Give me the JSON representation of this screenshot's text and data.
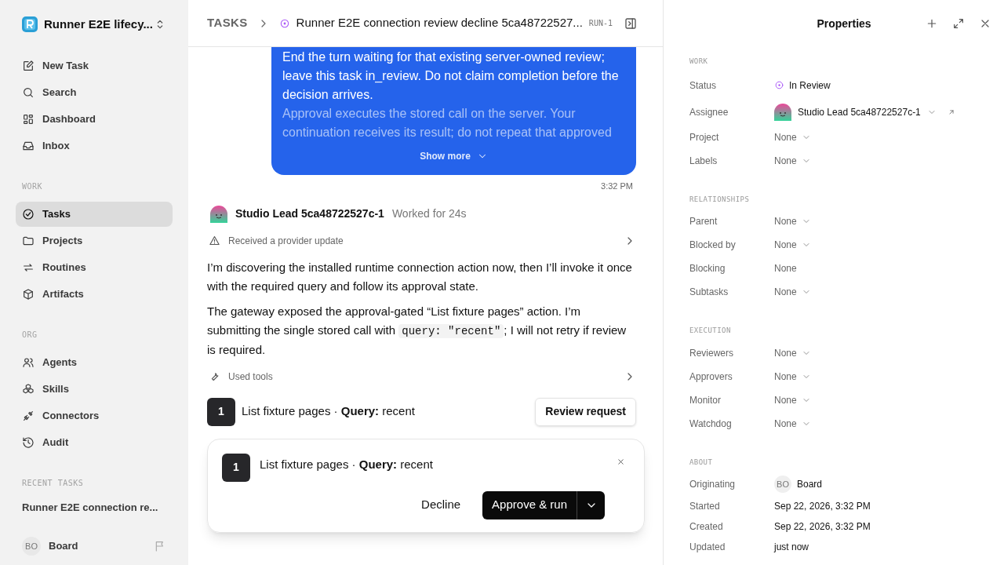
{
  "workspace": {
    "name": "Runner E2E lifecy..."
  },
  "sidebar": {
    "top_items": [
      {
        "label": "New Task"
      },
      {
        "label": "Search"
      },
      {
        "label": "Dashboard"
      },
      {
        "label": "Inbox"
      }
    ],
    "sections": [
      {
        "heading": "WORK",
        "items": [
          {
            "label": "Tasks",
            "selected": true
          },
          {
            "label": "Projects",
            "selected": false
          },
          {
            "label": "Routines",
            "selected": false
          },
          {
            "label": "Artifacts",
            "selected": false
          }
        ]
      },
      {
        "heading": "ORG",
        "items": [
          {
            "label": "Agents",
            "selected": false
          },
          {
            "label": "Skills",
            "selected": false
          },
          {
            "label": "Connectors",
            "selected": false
          },
          {
            "label": "Audit",
            "selected": false
          }
        ]
      }
    ],
    "recent": {
      "heading": "RECENT TASKS",
      "items": [
        "Runner E2E connection re..."
      ]
    },
    "user": {
      "initials": "BO",
      "name": "Board"
    }
  },
  "header": {
    "breadcrumb": "TASKS",
    "title": "Runner E2E connection review decline 5ca48722527...",
    "run": "RUN-1"
  },
  "message": {
    "text": "End the turn waiting for that existing server-owned review; leave this task in_review. Do not claim completion before the decision arrives.",
    "faded_text": "Approval executes the stored call on the server. Your continuation receives its result; do not repeat that approved",
    "show_more": "Show more",
    "time": "3:32 PM"
  },
  "agent": {
    "name": "Studio Lead 5ca48722527c-1",
    "worked": "Worked for 24s",
    "event": "Received a provider update",
    "paragraphs": [
      {
        "text": "I’m discovering the installed runtime connection action now, then I’ll invoke it once with the required query and follow its approval state."
      },
      {
        "text": "The gateway exposed the approval-gated “List fixture pages” action. I’m submitting the single stored call with ",
        "code": "query: \"recent\"",
        "after": "; I will not retry if review is required."
      }
    ],
    "tools": "Used tools",
    "request": {
      "number": "1",
      "text": "List fixture pages · **Query:** recent",
      "button": "Review request"
    }
  },
  "approval": {
    "number": "1",
    "text": "List fixture pages · **Query:** recent",
    "decline": "Decline",
    "approve": "Approve & run"
  },
  "properties": {
    "title": "Properties",
    "sections": [
      {
        "heading": "WORK",
        "rows": [
          {
            "label": "Status",
            "value": "In Review",
            "kind": "status"
          },
          {
            "label": "Assignee",
            "value": "Studio Lead 5ca48722527c-1",
            "kind": "person"
          },
          {
            "label": "Project",
            "value": "None",
            "kind": "dropdown"
          },
          {
            "label": "Labels",
            "value": "None",
            "kind": "dropdown"
          }
        ]
      },
      {
        "heading": "RELATIONSHIPS",
        "rows": [
          {
            "label": "Parent",
            "value": "None",
            "kind": "dropdown"
          },
          {
            "label": "Blocked by",
            "value": "None",
            "kind": "dropdown"
          },
          {
            "label": "Blocking",
            "value": "None",
            "kind": "plain"
          },
          {
            "label": "Subtasks",
            "value": "None",
            "kind": "dropdown"
          }
        ]
      },
      {
        "heading": "EXECUTION",
        "rows": [
          {
            "label": "Reviewers",
            "value": "None",
            "kind": "dropdown"
          },
          {
            "label": "Approvers",
            "value": "None",
            "kind": "dropdown"
          },
          {
            "label": "Monitor",
            "value": "None",
            "kind": "dropdown"
          },
          {
            "label": "Watchdog",
            "value": "None",
            "kind": "dropdown"
          }
        ]
      },
      {
        "heading": "ABOUT",
        "rows": [
          {
            "label": "Originating",
            "value": "Board",
            "initials": "BO",
            "kind": "initials"
          },
          {
            "label": "Started",
            "value": "Sep 22, 2026, 3:32 PM",
            "kind": "text"
          },
          {
            "label": "Created",
            "value": "Sep 22, 2026, 3:32 PM",
            "kind": "text"
          },
          {
            "label": "Updated",
            "value": "just now",
            "kind": "text"
          }
        ]
      }
    ]
  }
}
